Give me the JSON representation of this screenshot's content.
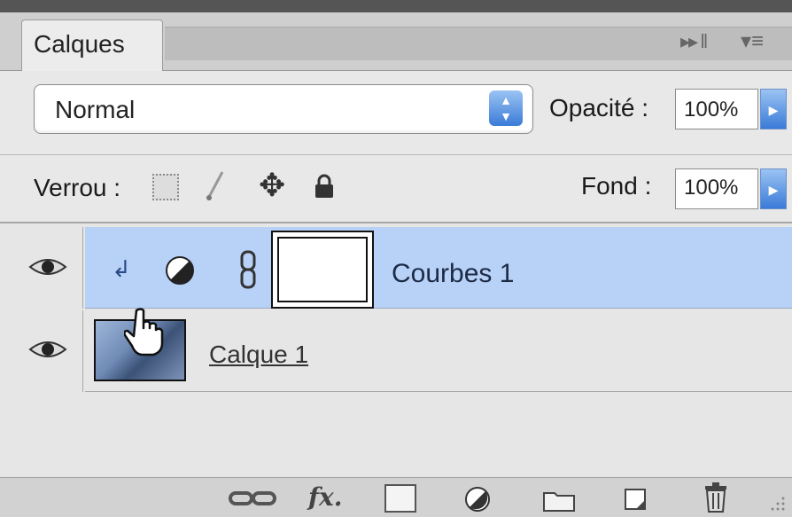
{
  "panel": {
    "tab_label": "Calques",
    "blend_mode": "Normal",
    "opacity_label": "Opacité :",
    "opacity_value": "100%",
    "lock_label": "Verrou :",
    "fill_label": "Fond :",
    "fill_value": "100%"
  },
  "layers": [
    {
      "name": "Courbes 1",
      "type": "adjustment",
      "visible": true,
      "selected": true
    },
    {
      "name": "Calque 1",
      "type": "pixel",
      "visible": true,
      "selected": false
    }
  ],
  "icons": {
    "collapse": "double-arrow-collapse",
    "panel_menu": "panel-menu",
    "lock_transparent": "lock-transparent-pixels",
    "lock_image": "lock-image-pixels",
    "lock_position": "lock-position",
    "lock_all": "lock-all",
    "eye": "eye",
    "clip": "clipping-arrow",
    "adjustment": "adjustment-layer",
    "link": "chain-link",
    "cursor": "hand-pointer",
    "bottom": [
      "link-layers",
      "fx",
      "add-mask",
      "new-adjustment",
      "new-group",
      "new-layer",
      "trash"
    ]
  },
  "colors": {
    "selected_row": "#b7d1f7",
    "accent": "#3a7bd8"
  }
}
